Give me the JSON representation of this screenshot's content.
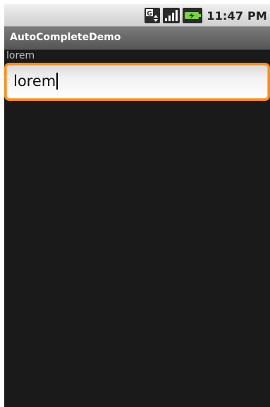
{
  "status_bar": {
    "time": "11:47 PM",
    "icons": [
      "data-sync-icon",
      "signal-strength-icon",
      "battery-charging-icon"
    ]
  },
  "app": {
    "title": "AutoCompleteDemo"
  },
  "selection": {
    "label": "lorem"
  },
  "autocomplete": {
    "value": "lorem",
    "focused": true
  },
  "colors": {
    "focus_ring": "#ff8c1a",
    "background": "#1a1a1a",
    "title_bar": "#6a6a6a"
  }
}
